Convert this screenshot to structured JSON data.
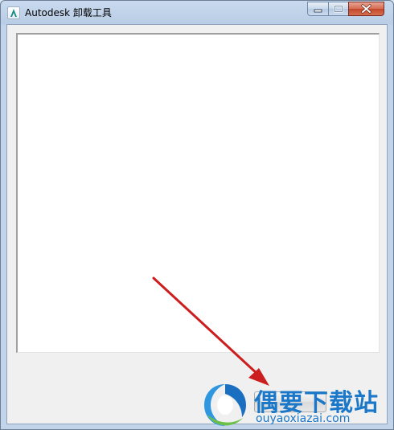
{
  "window": {
    "title": "Autodesk 卸载工具",
    "app_icon": "autodesk-logo-icon"
  },
  "controls": {
    "minimize_icon": "minimize-icon",
    "maximize_icon": "maximize-icon",
    "close_icon": "close-icon"
  },
  "main": {
    "uninstall_button_label": ""
  },
  "watermark": {
    "text": "偶要下载站",
    "url": "ouyaoxiazai.com",
    "logo_icon": "ouyao-logo-icon"
  },
  "annotation": {
    "arrow_icon": "red-arrow-icon",
    "arrow_color": "#cc1e1e"
  },
  "colors": {
    "accent": "#1b78c8",
    "close_red": "#c3462a"
  }
}
